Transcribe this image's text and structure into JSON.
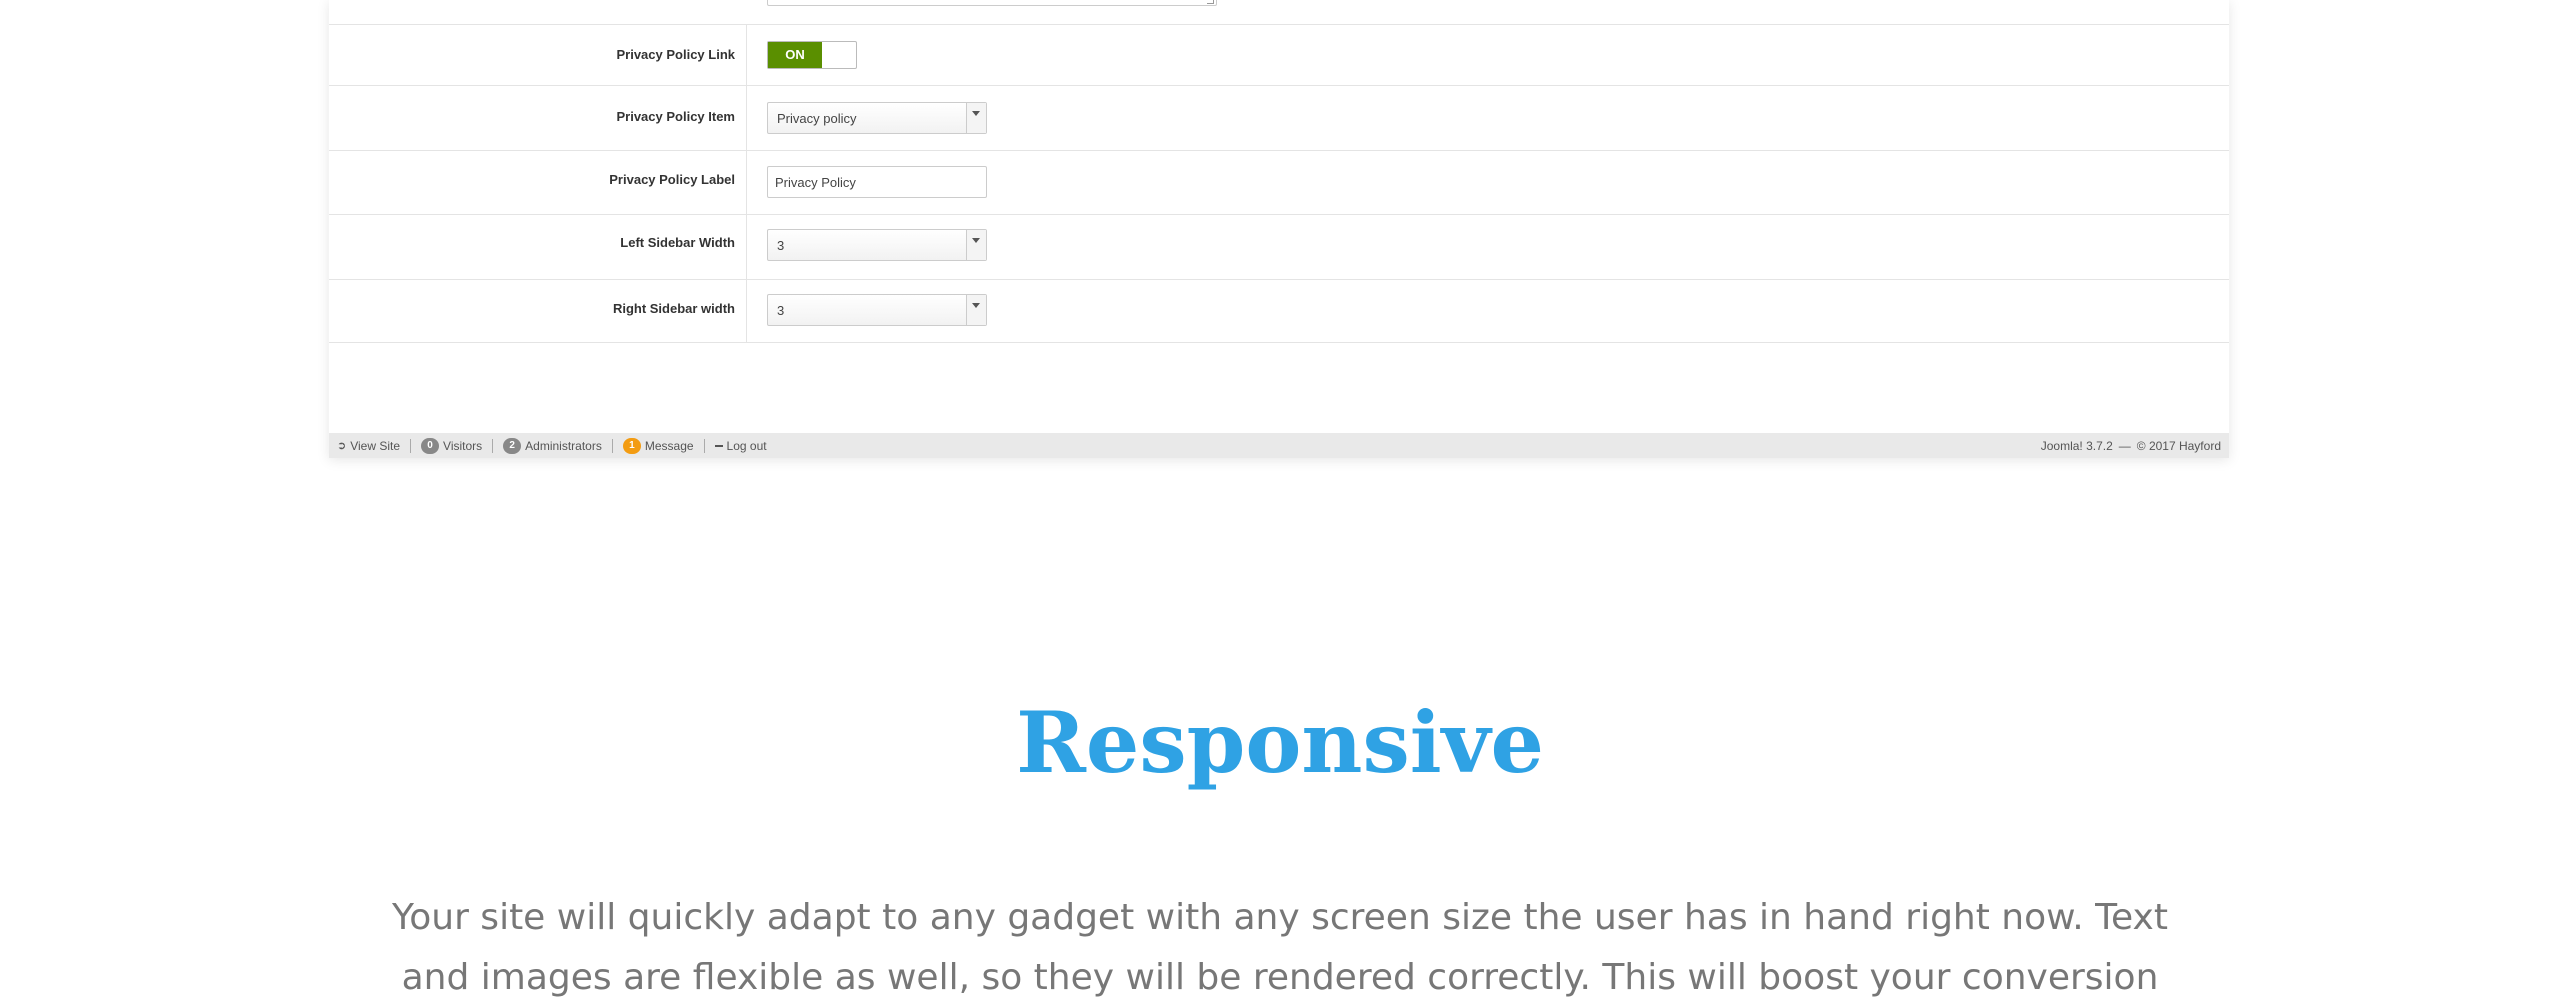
{
  "form": {
    "rows": [
      {
        "label": "Privacy Policy Link",
        "toggle_value": "ON"
      },
      {
        "label": "Privacy Policy Item",
        "select_value": "Privacy policy"
      },
      {
        "label": "Privacy Policy Label",
        "input_value": "Privacy Policy"
      },
      {
        "label": "Left Sidebar Width",
        "select_value": "3"
      },
      {
        "label": "Right Sidebar width",
        "select_value": "3"
      }
    ]
  },
  "status_bar": {
    "view_site": "View Site",
    "visitors_count": "0",
    "visitors_label": "Visitors",
    "admins_count": "2",
    "admins_label": "Administrators",
    "message_count": "1",
    "message_label": "Message",
    "logout": "Log out",
    "version": "Joomla! 3.7.2",
    "dash": "—",
    "copyright": "© 2017 Hayford"
  },
  "hero": {
    "title": "Responsive",
    "text": "Your site will quickly adapt to any gadget with any screen size the user has in hand right now. Text and images are flexible as well, so they will be rendered correctly. This will boost your conversion"
  },
  "colors": {
    "toggle_on": "#5a8f00",
    "title": "#2fa2e4",
    "message_badge": "#f39c12",
    "count_badge": "#888888"
  }
}
